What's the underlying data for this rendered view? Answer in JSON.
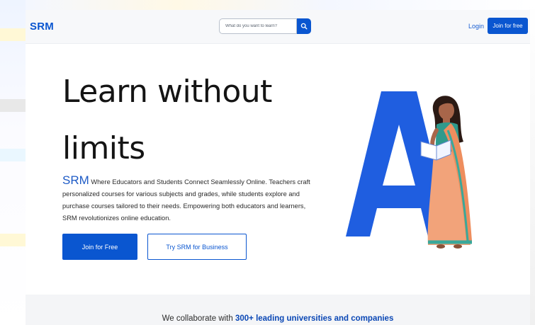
{
  "header": {
    "brand": "SRM",
    "search_placeholder": "What do you want to learn?",
    "login_label": "Login",
    "join_label": "Join for free"
  },
  "hero": {
    "title_line1": "Learn without",
    "title_line2": "limits",
    "desc_brand": "SRM",
    "description": " Where Educators and Students Connect Seamlessly Online. Teachers craft personalized courses for various subjects and grades, while students explore and purchase courses tailored to their needs. Empowering both educators and learners, SRM revolutionizes online education.",
    "primary_button": "Join for Free",
    "secondary_button": "Try SRM for Business"
  },
  "collaborate": {
    "prefix": "We collaborate with ",
    "highlight": "300+ leading universities and companies"
  },
  "colors": {
    "brand_blue": "#0a56d0",
    "saree_orange": "#f2a37a",
    "saree_border": "#3aa89a"
  },
  "icons": {
    "search": "search-icon",
    "illustration": "teacher-illustration"
  }
}
